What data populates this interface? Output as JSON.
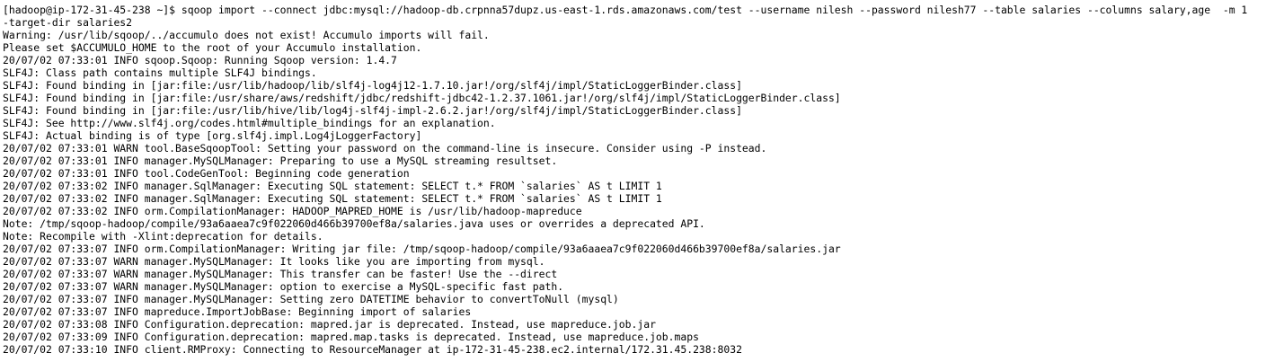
{
  "terminal": {
    "lines": [
      "[hadoop@ip-172-31-45-238 ~]$ sqoop import --connect jdbc:mysql://hadoop-db.crpnna57dupz.us-east-1.rds.amazonaws.com/test --username nilesh --password nilesh77 --table salaries --columns salary,age  -m 1",
      "-target-dir salaries2",
      "Warning: /usr/lib/sqoop/../accumulo does not exist! Accumulo imports will fail.",
      "Please set $ACCUMULO_HOME to the root of your Accumulo installation.",
      "20/07/02 07:33:01 INFO sqoop.Sqoop: Running Sqoop version: 1.4.7",
      "SLF4J: Class path contains multiple SLF4J bindings.",
      "SLF4J: Found binding in [jar:file:/usr/lib/hadoop/lib/slf4j-log4j12-1.7.10.jar!/org/slf4j/impl/StaticLoggerBinder.class]",
      "SLF4J: Found binding in [jar:file:/usr/share/aws/redshift/jdbc/redshift-jdbc42-1.2.37.1061.jar!/org/slf4j/impl/StaticLoggerBinder.class]",
      "SLF4J: Found binding in [jar:file:/usr/lib/hive/lib/log4j-slf4j-impl-2.6.2.jar!/org/slf4j/impl/StaticLoggerBinder.class]",
      "SLF4J: See http://www.slf4j.org/codes.html#multiple_bindings for an explanation.",
      "SLF4J: Actual binding is of type [org.slf4j.impl.Log4jLoggerFactory]",
      "20/07/02 07:33:01 WARN tool.BaseSqoopTool: Setting your password on the command-line is insecure. Consider using -P instead.",
      "20/07/02 07:33:01 INFO manager.MySQLManager: Preparing to use a MySQL streaming resultset.",
      "20/07/02 07:33:01 INFO tool.CodeGenTool: Beginning code generation",
      "20/07/02 07:33:02 INFO manager.SqlManager: Executing SQL statement: SELECT t.* FROM `salaries` AS t LIMIT 1",
      "20/07/02 07:33:02 INFO manager.SqlManager: Executing SQL statement: SELECT t.* FROM `salaries` AS t LIMIT 1",
      "20/07/02 07:33:02 INFO orm.CompilationManager: HADOOP_MAPRED_HOME is /usr/lib/hadoop-mapreduce",
      "Note: /tmp/sqoop-hadoop/compile/93a6aaea7c9f022060d466b39700ef8a/salaries.java uses or overrides a deprecated API.",
      "Note: Recompile with -Xlint:deprecation for details.",
      "20/07/02 07:33:07 INFO orm.CompilationManager: Writing jar file: /tmp/sqoop-hadoop/compile/93a6aaea7c9f022060d466b39700ef8a/salaries.jar",
      "20/07/02 07:33:07 WARN manager.MySQLManager: It looks like you are importing from mysql.",
      "20/07/02 07:33:07 WARN manager.MySQLManager: This transfer can be faster! Use the --direct",
      "20/07/02 07:33:07 WARN manager.MySQLManager: option to exercise a MySQL-specific fast path.",
      "20/07/02 07:33:07 INFO manager.MySQLManager: Setting zero DATETIME behavior to convertToNull (mysql)",
      "20/07/02 07:33:07 INFO mapreduce.ImportJobBase: Beginning import of salaries",
      "20/07/02 07:33:08 INFO Configuration.deprecation: mapred.jar is deprecated. Instead, use mapreduce.job.jar",
      "20/07/02 07:33:09 INFO Configuration.deprecation: mapred.map.tasks is deprecated. Instead, use mapreduce.job.maps",
      "20/07/02 07:33:10 INFO client.RMProxy: Connecting to ResourceManager at ip-172-31-45-238.ec2.internal/172.31.45.238:8032"
    ]
  }
}
